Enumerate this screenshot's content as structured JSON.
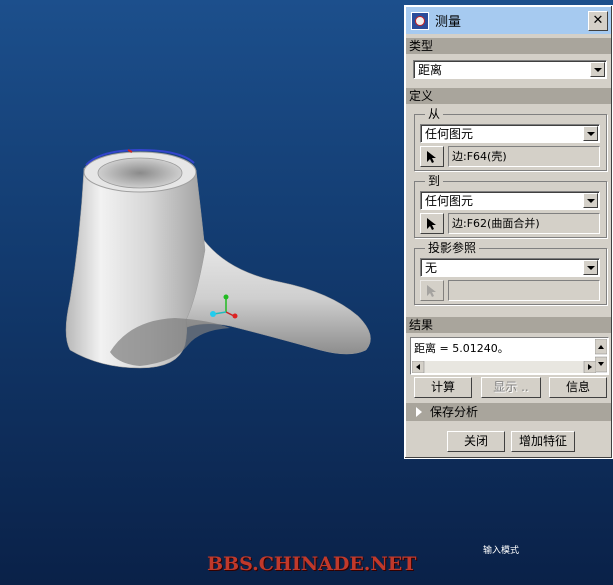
{
  "dialog": {
    "title": "测量",
    "type_section": "类型",
    "type_value": "距离",
    "definition_section": "定义",
    "from_group": "从",
    "from_entity": "任何图元",
    "from_ref": "边:F64(壳)",
    "to_group": "到",
    "to_entity": "任何图元",
    "to_ref": "边:F62(曲面合并)",
    "projection_group": "投影参照",
    "projection_value": "无",
    "projection_ref": "",
    "result_section": "结果",
    "result_text": "距离 = 5.01240。",
    "compute_label": "计算",
    "show_label": "显示 ..",
    "info_label": "信息",
    "save_analysis_label": "保存分析",
    "close_label": "关闭",
    "add_feature_label": "增加特征"
  },
  "watermark": "BBS.CHINADE.NET",
  "status": {
    "input_mode": "输入模式"
  },
  "colors": {
    "background_top": "#1c4f8c",
    "background_bottom": "#0a2148",
    "dialog_face": "#d4d0c8",
    "section_bar": "#a9a59c",
    "titlebar": "#a6caf0",
    "watermark": "#c0392b"
  }
}
